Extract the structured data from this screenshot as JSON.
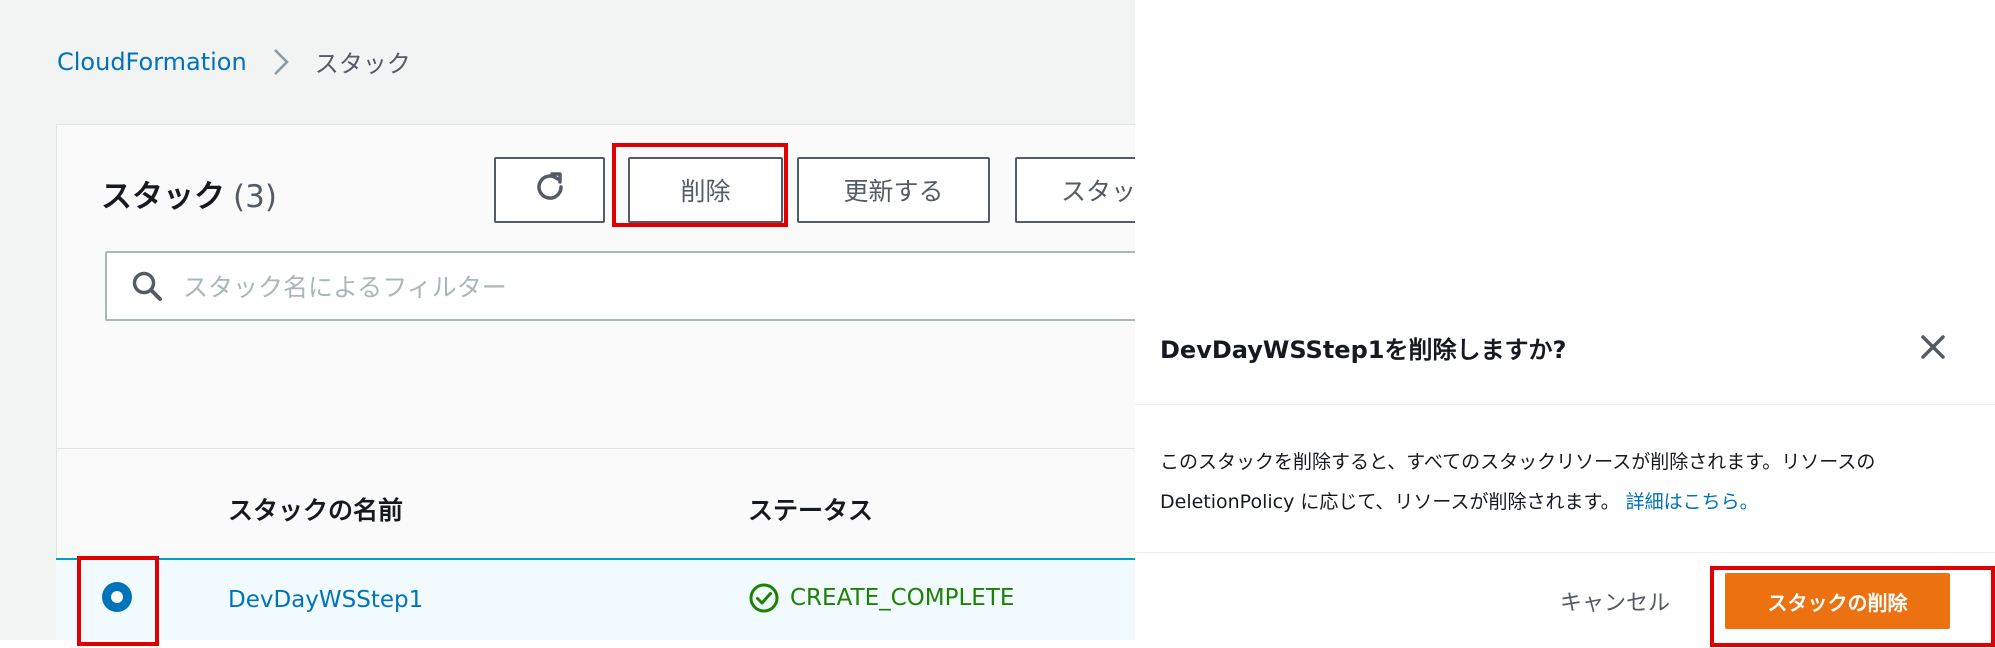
{
  "breadcrumb": {
    "root": "CloudFormation",
    "current": "スタック"
  },
  "panel": {
    "title": "スタック",
    "count": "(3)"
  },
  "toolbar": {
    "refresh_icon": "refresh-icon",
    "delete_label": "削除",
    "update_label": "更新する",
    "stack_actions_label": "スタッ"
  },
  "search": {
    "placeholder": "スタック名によるフィルター",
    "icon": "search-icon"
  },
  "table": {
    "columns": [
      "スタックの名前",
      "ステータス"
    ],
    "rows": [
      {
        "name": "DevDayWSStep1",
        "status": "CREATE_COMPLETE",
        "selected": true
      }
    ]
  },
  "modal": {
    "title": "DevDayWSStep1を削除しますか?",
    "body_line1": "このスタックを削除すると、すべてのスタックリソースが削除されます。リソースの",
    "body_line2": "DeletionPolicy に応じて、リソースが削除されます。",
    "body_link": "詳細はこちら。",
    "cancel_label": "キャンセル",
    "confirm_label": "スタックの削除"
  },
  "colors": {
    "accent": "#ec7211",
    "link": "#0073bb",
    "highlight": "#e00000",
    "success": "#1d8102"
  }
}
